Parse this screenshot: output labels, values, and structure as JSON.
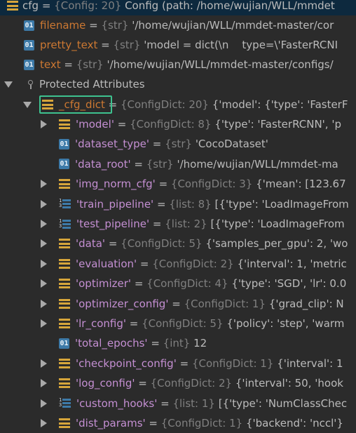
{
  "top": {
    "name": "cfg",
    "type_info": "{Config: 20}",
    "value": "Config (path: /home/wujian/WLL/mmdet"
  },
  "fields": [
    {
      "name": "filename",
      "type_info": "{str}",
      "value": "'/home/wujian/WLL/mmdet-master/cor",
      "icon": "01"
    },
    {
      "name": "pretty_text",
      "type_info": "{str}",
      "value": "'model = dict(\\n    type=\\'FasterRCNI",
      "icon": "01"
    },
    {
      "name": "text",
      "type_info": "{str}",
      "value": "'/home/wujian/WLL/mmdet-master/configs/",
      "icon": "01"
    }
  ],
  "protected_label": "Protected Attributes",
  "cfg_dict": {
    "name": "_cfg_dict",
    "type_info": "{ConfigDict: 20}",
    "value": "{'model': {'type': 'FasterF"
  },
  "entries": [
    {
      "name": "'model'",
      "type_info": "{ConfigDict: 8}",
      "value": "{'type': 'FasterRCNN', 'p",
      "icon": "dict",
      "expandable": true
    },
    {
      "name": "'dataset_type'",
      "type_info": "{str}",
      "value": "'CocoDataset'",
      "icon": "01",
      "expandable": false
    },
    {
      "name": "'data_root'",
      "type_info": "{str}",
      "value": "'/home/wujian/WLL/mmdet-ma",
      "icon": "01",
      "expandable": false
    },
    {
      "name": "'img_norm_cfg'",
      "type_info": "{ConfigDict: 3}",
      "value": "{'mean': [123.67",
      "icon": "dict",
      "expandable": true
    },
    {
      "name": "'train_pipeline'",
      "type_info": "{list: 8}",
      "value": "[{'type': 'LoadImageFrom",
      "icon": "list",
      "expandable": true
    },
    {
      "name": "'test_pipeline'",
      "type_info": "{list: 2}",
      "value": "[{'type': 'LoadImageFrom",
      "icon": "list",
      "expandable": true
    },
    {
      "name": "'data'",
      "type_info": "{ConfigDict: 5}",
      "value": "{'samples_per_gpu': 2, 'wo",
      "icon": "dict",
      "expandable": true
    },
    {
      "name": "'evaluation'",
      "type_info": "{ConfigDict: 2}",
      "value": "{'interval': 1, 'metric",
      "icon": "dict",
      "expandable": true
    },
    {
      "name": "'optimizer'",
      "type_info": "{ConfigDict: 4}",
      "value": "{'type': 'SGD', 'lr': 0.0",
      "icon": "dict",
      "expandable": true
    },
    {
      "name": "'optimizer_config'",
      "type_info": "{ConfigDict: 1}",
      "value": "{'grad_clip': N",
      "icon": "dict",
      "expandable": true
    },
    {
      "name": "'lr_config'",
      "type_info": "{ConfigDict: 5}",
      "value": "{'policy': 'step', 'warm",
      "icon": "dict",
      "expandable": true
    },
    {
      "name": "'total_epochs'",
      "type_info": "{int}",
      "value": "12",
      "icon": "01",
      "expandable": false
    },
    {
      "name": "'checkpoint_config'",
      "type_info": "{ConfigDict: 1}",
      "value": "{'interval': 1",
      "icon": "dict",
      "expandable": true
    },
    {
      "name": "'log_config'",
      "type_info": "{ConfigDict: 2}",
      "value": "{'interval': 50, 'hook",
      "icon": "dict",
      "expandable": true
    },
    {
      "name": "'custom_hooks'",
      "type_info": "{list: 1}",
      "value": "[{'type': 'NumClassChec",
      "icon": "list",
      "expandable": true
    },
    {
      "name": "'dist_params'",
      "type_info": "{ConfigDict: 1}",
      "value": "{'backend': 'nccl'}",
      "icon": "dict",
      "expandable": true
    }
  ],
  "list_icon_digits": "1\n3",
  "icon_01_text": "01"
}
